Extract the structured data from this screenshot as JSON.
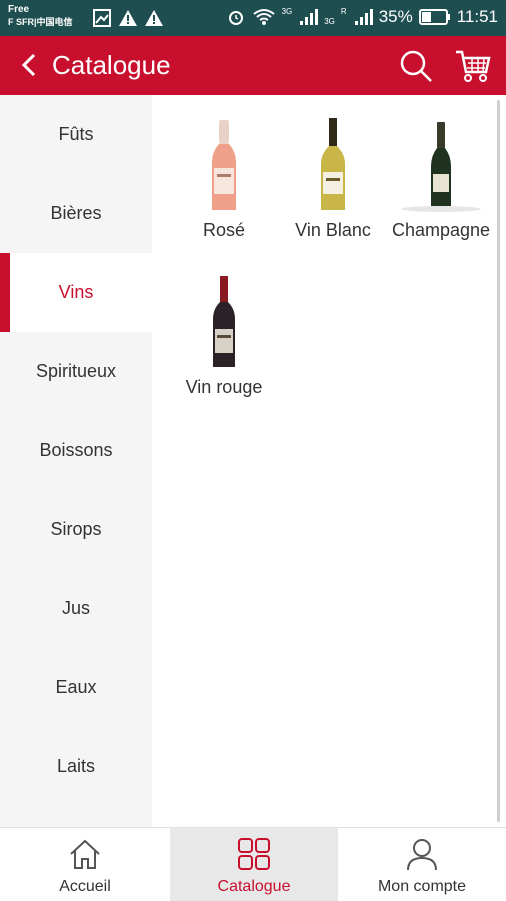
{
  "status_bar": {
    "carrier_line1": "Free",
    "carrier_line2": "F SFR|中国电信",
    "network_3g_a": "3G",
    "network_3g_b": "3G",
    "network_r": "R",
    "battery": "35%",
    "time": "11:51"
  },
  "header": {
    "title": "Catalogue",
    "back_icon": "chevron-left-icon",
    "search_icon": "search-icon",
    "cart_icon": "cart-icon"
  },
  "categories": [
    {
      "label": "Fûts"
    },
    {
      "label": "Bières"
    },
    {
      "label": "Vins",
      "active": true
    },
    {
      "label": "Spiritueux"
    },
    {
      "label": "Boissons"
    },
    {
      "label": "Sirops"
    },
    {
      "label": "Jus"
    },
    {
      "label": "Eaux"
    },
    {
      "label": "Laits"
    }
  ],
  "products": [
    {
      "name": "Rosé",
      "image": "rose-bottle"
    },
    {
      "name": "Vin Blanc",
      "image": "white-wine-bottle"
    },
    {
      "name": "Champagne",
      "image": "champagne-bottle"
    },
    {
      "name": "Vin rouge",
      "image": "red-wine-bottle"
    }
  ],
  "bottom_nav": [
    {
      "label": "Accueil",
      "icon": "home-icon"
    },
    {
      "label": "Catalogue",
      "icon": "grid-icon",
      "active": true
    },
    {
      "label": "Mon compte",
      "icon": "user-icon"
    }
  ],
  "colors": {
    "brand_red": "#c8102e",
    "status_bar": "#1f4e51",
    "sidebar_bg": "#f5f5f5"
  }
}
